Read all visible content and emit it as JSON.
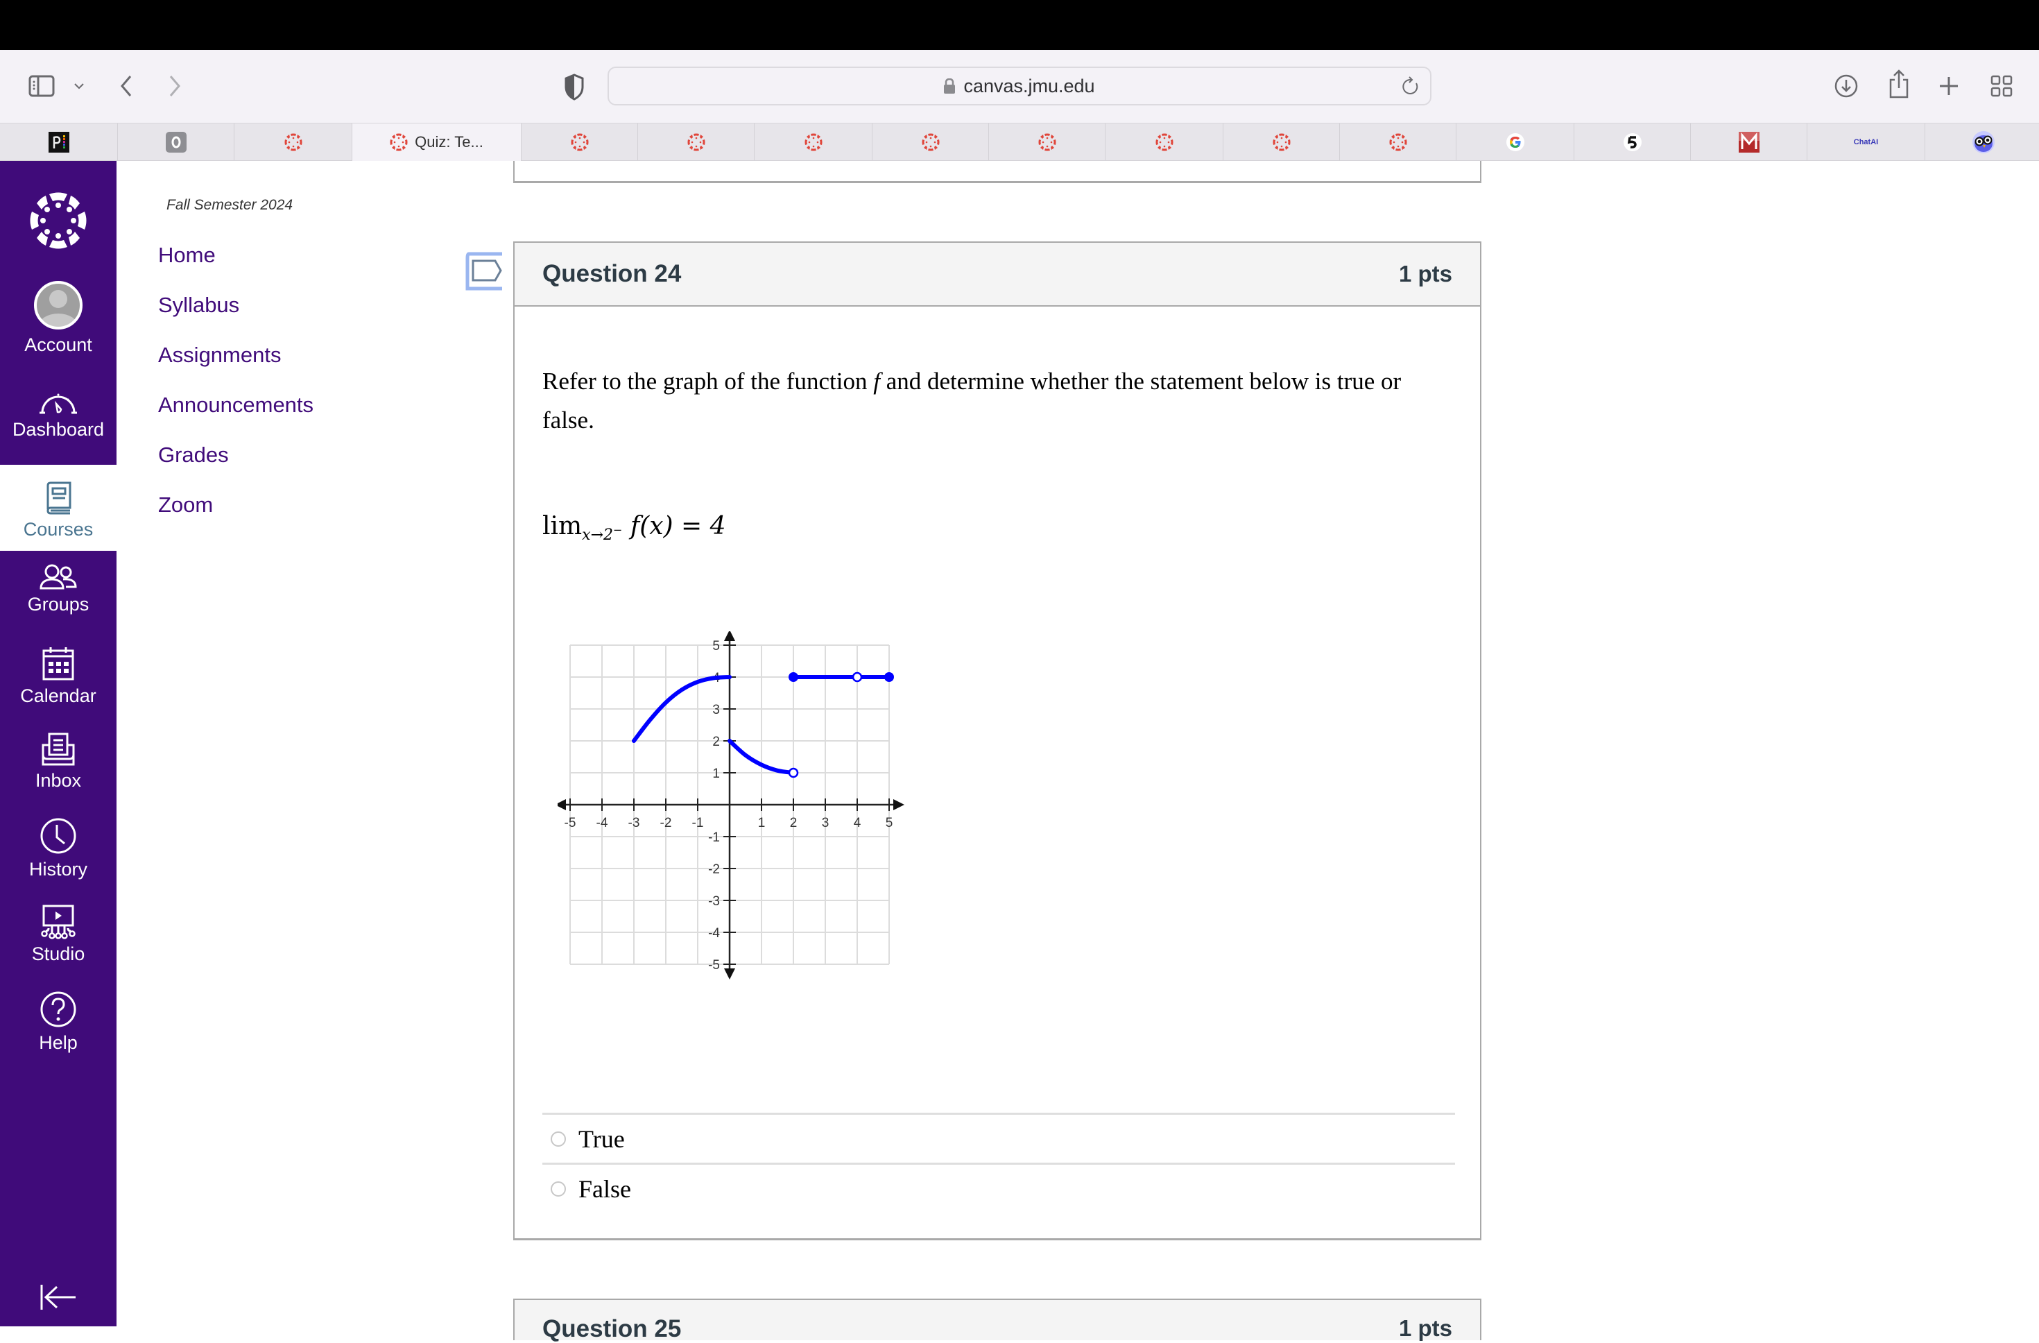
{
  "browser": {
    "url": "canvas.jmu.edu",
    "icons": [
      "sidebar-icon",
      "chevron-down-icon",
      "back-icon",
      "forward-icon",
      "privacy-shield-icon",
      "lock-icon",
      "reload-icon",
      "download-icon",
      "share-icon",
      "new-tab-icon",
      "tab-overview-icon"
    ],
    "tabs": [
      {
        "icon": "pearson-icon",
        "title": ""
      },
      {
        "icon": "o-app-icon",
        "title": ""
      },
      {
        "icon": "canvas-icon",
        "title": ""
      },
      {
        "icon": "canvas-icon",
        "title": "Quiz: Te...",
        "active": true
      },
      {
        "icon": "canvas-icon",
        "title": ""
      },
      {
        "icon": "canvas-icon",
        "title": ""
      },
      {
        "icon": "canvas-icon",
        "title": ""
      },
      {
        "icon": "canvas-icon",
        "title": ""
      },
      {
        "icon": "canvas-icon",
        "title": ""
      },
      {
        "icon": "canvas-icon",
        "title": ""
      },
      {
        "icon": "canvas-icon",
        "title": ""
      },
      {
        "icon": "canvas-icon",
        "title": ""
      },
      {
        "icon": "google-icon",
        "title": ""
      },
      {
        "icon": "swirl-app-icon",
        "title": ""
      },
      {
        "icon": "m-app-icon",
        "title": ""
      },
      {
        "icon": "chatai-icon",
        "title": "ChatAI"
      },
      {
        "icon": "owl-icon",
        "title": ""
      }
    ]
  },
  "global_nav": {
    "brand_color": "#400b7a",
    "active_color": "#4a7590",
    "items": [
      {
        "label": "Account",
        "icon": "avatar-icon"
      },
      {
        "label": "Dashboard",
        "icon": "speedometer-icon"
      },
      {
        "label": "Courses",
        "icon": "book-icon",
        "active": true
      },
      {
        "label": "Groups",
        "icon": "groups-icon"
      },
      {
        "label": "Calendar",
        "icon": "calendar-icon"
      },
      {
        "label": "Inbox",
        "icon": "inbox-icon"
      },
      {
        "label": "History",
        "icon": "clock-icon"
      },
      {
        "label": "Studio",
        "icon": "studio-icon"
      },
      {
        "label": "Help",
        "icon": "help-icon"
      }
    ],
    "collapse_icon": "collapse-nav-icon"
  },
  "course_nav": {
    "term": "Fall Semester 2024",
    "links": [
      "Home",
      "Syllabus",
      "Assignments",
      "Announcements",
      "Grades",
      "Zoom"
    ]
  },
  "question": {
    "name": "Question 24",
    "points": "1 pts",
    "text_before_f": "Refer to the graph of the function ",
    "f": "f",
    "text_after_f": " and determine whether the statement below is true or false.",
    "statement": {
      "lim": "lim",
      "subscript": "x→2",
      "superscript": "−",
      "expr": "f(x) = 4"
    },
    "answers": [
      {
        "label": "True",
        "selected": false
      },
      {
        "label": "False",
        "selected": false
      }
    ]
  },
  "graph": {
    "x_ticks": [
      "-5",
      "-4",
      "-3",
      "-2",
      "-1",
      "1",
      "2",
      "3",
      "4",
      "5"
    ],
    "y_ticks": [
      "5",
      "4",
      "3",
      "2",
      "1",
      "-1",
      "-2",
      "-3",
      "-4",
      "-5"
    ],
    "x_range": [
      -5,
      5
    ],
    "y_range": [
      -5,
      5
    ],
    "curve_color": "#0000ff",
    "pieces": [
      {
        "name": "rising-arc",
        "points": [
          [
            -3,
            2
          ],
          [
            -2.5,
            2.65
          ],
          [
            -2,
            3.2
          ],
          [
            -1.5,
            3.6
          ],
          [
            -1,
            3.85
          ],
          [
            -0.5,
            3.97
          ],
          [
            0,
            4
          ]
        ],
        "start": "none",
        "end": "none"
      },
      {
        "name": "falling-arc",
        "points": [
          [
            0,
            2
          ],
          [
            0.5,
            1.55
          ],
          [
            1,
            1.25
          ],
          [
            1.5,
            1.07
          ],
          [
            2,
            1
          ]
        ],
        "start": "none",
        "end": "open"
      },
      {
        "name": "horizontal-segment",
        "points": [
          [
            2,
            4
          ],
          [
            5,
            4
          ]
        ],
        "start": "closed",
        "end": "closed"
      }
    ],
    "extra_points": [
      {
        "x": 4,
        "y": 4,
        "type": "open"
      }
    ]
  },
  "next_question": {
    "name": "Question 25",
    "points": "1 pts"
  }
}
